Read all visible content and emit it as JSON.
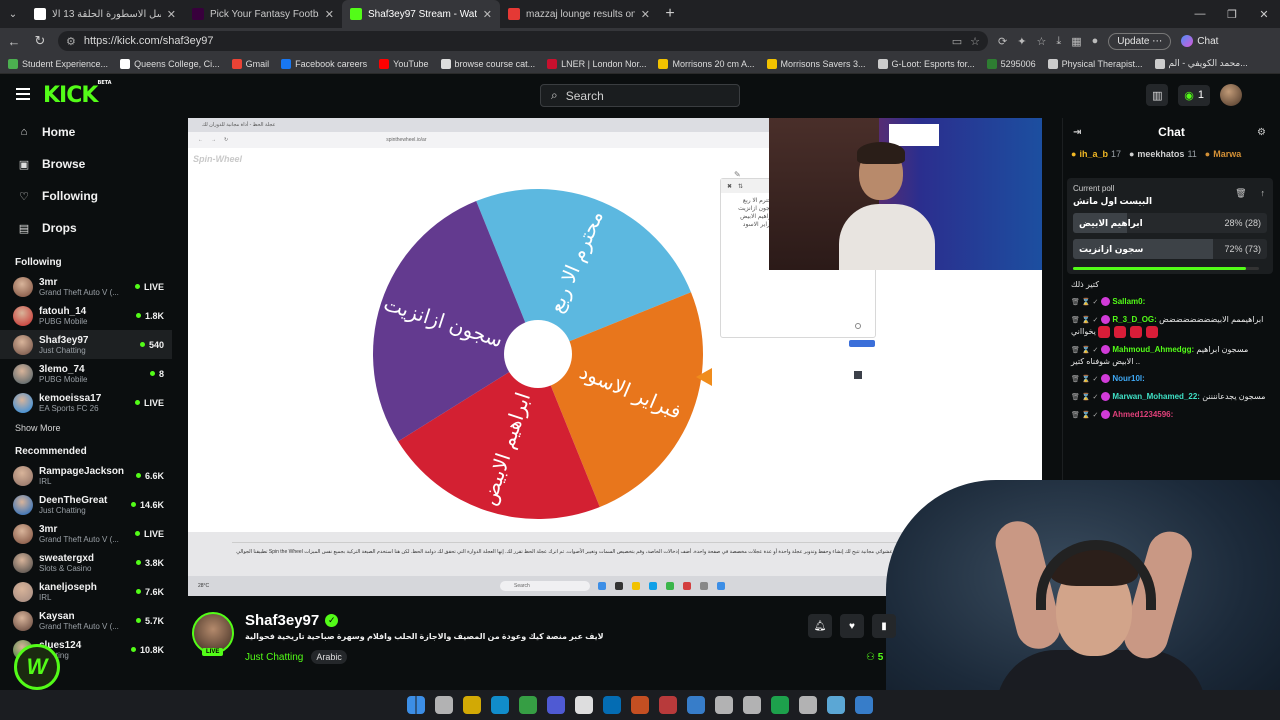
{
  "browser": {
    "tabs": [
      {
        "title": "مسلسل الاسطورة الحلقة 13 الا",
        "favicon_color": "#ffffff",
        "active": false
      },
      {
        "title": "Pick Your Fantasy Football Team |",
        "favicon_color": "#38003c",
        "active": false
      },
      {
        "title": "Shaf3ey97 Stream - Watch Live",
        "favicon_color": "#53fc18",
        "active": true
      },
      {
        "title": "mazzaj lounge results on Sou",
        "favicon_color": "#e53935",
        "active": false
      }
    ],
    "url": "https://kick.com/shaf3ey97",
    "update_label": "Update",
    "chat_label": "Chat",
    "bookmarks": [
      {
        "label": "Student Experience...",
        "color": "#4caf50"
      },
      {
        "label": "Queens College, Ci...",
        "color": "#ffffff"
      },
      {
        "label": "Gmail",
        "color": "#ea4335"
      },
      {
        "label": "Facebook careers",
        "color": "#1877f2"
      },
      {
        "label": "YouTube",
        "color": "#ff0000"
      },
      {
        "label": "browse course cat...",
        "color": "#dddddd"
      },
      {
        "label": "LNER | London Nor...",
        "color": "#c8102e"
      },
      {
        "label": "Morrisons 20 cm A...",
        "color": "#f2c200"
      },
      {
        "label": "Morrisons Savers 3...",
        "color": "#f2c200"
      },
      {
        "label": "G-Loot: Esports for...",
        "color": "#cccccc"
      },
      {
        "label": "5295006",
        "color": "#2e7d32"
      },
      {
        "label": "Physical Therapist...",
        "color": "#cccccc"
      },
      {
        "label": "محمد الكويفي - الم...",
        "color": "#cccccc"
      }
    ]
  },
  "header": {
    "logo": "KICK",
    "logo_badge": "BETA",
    "search_placeholder": "Search",
    "notification_count": "1"
  },
  "sidebar": {
    "nav": [
      {
        "label": "Home",
        "icon": "home-icon",
        "glyph": "⌂"
      },
      {
        "label": "Browse",
        "icon": "browse-icon",
        "glyph": "▣"
      },
      {
        "label": "Following",
        "icon": "heart-icon",
        "glyph": "♡"
      },
      {
        "label": "Drops",
        "icon": "drops-icon",
        "glyph": "▤"
      }
    ],
    "following_title": "Following",
    "following": [
      {
        "name": "3mr",
        "category": "Grand Theft Auto V (...",
        "viewers": "LIVE",
        "color": "#7a4b3a"
      },
      {
        "name": "fatouh_14",
        "category": "PUBG Mobile",
        "viewers": "1.8K",
        "color": "#c62828"
      },
      {
        "name": "Shaf3ey97",
        "category": "Just Chatting",
        "viewers": "540",
        "color": "#6d4c41"
      },
      {
        "name": "3lemo_74",
        "category": "PUBG Mobile",
        "viewers": "8",
        "color": "#455a64"
      },
      {
        "name": "kemoeissa17",
        "category": "EA Sports FC 26",
        "viewers": "LIVE",
        "color": "#1e88e5"
      }
    ],
    "show_more": "Show More",
    "recommended_title": "Recommended",
    "recommended": [
      {
        "name": "RampageJackson",
        "category": "IRL",
        "viewers": "6.6K",
        "color": "#8d6e63"
      },
      {
        "name": "DeenTheGreat",
        "category": "Just Chatting",
        "viewers": "14.6K",
        "color": "#1565c0"
      },
      {
        "name": "3mr",
        "category": "Grand Theft Auto V (...",
        "viewers": "LIVE",
        "color": "#7a4b3a"
      },
      {
        "name": "sweatergxd",
        "category": "Slots & Casino",
        "viewers": "3.8K",
        "color": "#424242"
      },
      {
        "name": "kaneljoseph",
        "category": "IRL",
        "viewers": "7.6K",
        "color": "#a1887f"
      },
      {
        "name": "Kaysan",
        "category": "Grand Theft Auto V (...",
        "viewers": "5.7K",
        "color": "#5d4037"
      },
      {
        "name": "clues124",
        "category": "Chatting",
        "viewers": "10.8K",
        "color": "#2e7d32"
      }
    ]
  },
  "video": {
    "inner_logo": "Spin-Wheel",
    "inner_url": "spinthewheel.io/ar",
    "inner_tab": "عجلة الحظ - أداة مجانية للدوران لك",
    "wheel": {
      "segments": [
        {
          "label": "محترم الا ربع",
          "color": "#5cb8e0"
        },
        {
          "label": "فبراير الاسود",
          "color": "#e8761c"
        },
        {
          "label": "ابراهيم الابيض",
          "color": "#d32032"
        },
        {
          "label": "سجون ازانزيت",
          "color": "#633a8f"
        }
      ]
    },
    "entries": [
      "محترم الا ربع",
      "سجون ازانزيت",
      "ابراهيم الابيض",
      "فبراير الاسود"
    ],
    "description": "هي أداة اختيار رقم عشوائي مجانية تتيح لك إنشاء وحفظ وتدوير عجلة واحدة أو عدة عجلات مخصصة في صفحة واحدة. أضف إدخالات الخاصة، وقم بتخصيص السمات وتغيير الأصوات. ثم اترك عجلة الحظ تقرر لك. إنها العجلة الدوارة التي تحقق لك دوامة الحظ. لكن هنا استخدم الصيغة التركية بجميع نفس الميزات Spin the Wheel تطبيقنا الجوالي بمجانيا.",
    "weather": "28°C",
    "taskbar_search": "Search"
  },
  "stream": {
    "streamer": "Shaf3ey97",
    "live_badge": "LIVE",
    "title": "لايف عبر منصة كيك وعودة من المصيف والاجازة الحلب وافلام وسهرة صباحية تاريخية فحوالية",
    "category": "Just Chatting",
    "language": "Arabic",
    "viewer_count": "5"
  },
  "chat": {
    "title": "Chat",
    "leaders": [
      {
        "name": "ih_a_b",
        "count": "17",
        "color": "#f2b824"
      },
      {
        "name": "meekhatos",
        "count": "11",
        "color": "#cfcfcf"
      },
      {
        "name": "Marwa",
        "count": "",
        "color": "#d39036"
      }
    ],
    "poll": {
      "label": "Current poll",
      "question": "البيست اول ماتش",
      "options": [
        {
          "label": "ابراهيم الابيض",
          "result": "28% (28)",
          "percent": 28
        },
        {
          "label": "سجون ازانزيت",
          "result": "72% (73)",
          "percent": 72
        }
      ],
      "time_remaining": 0.93
    },
    "messages": [
      {
        "user": "",
        "color": "#ffffff",
        "text": "كتير ذلك"
      },
      {
        "user": "Sallam0:",
        "color": "#53fc18",
        "text": ""
      },
      {
        "user": "R_3_D_OG:",
        "color": "#53fc18",
        "text": "ابراهيممم الابيضضضضضضضض يخوااني"
      },
      {
        "user": "Mahmoud_Ahmedgg:",
        "color": "#53fc18",
        "text": "مسجون ابراهيم الابيض شوفناه كتير .."
      },
      {
        "user": "Nour10l:",
        "color": "#3fa9f5",
        "text": ""
      },
      {
        "user": "Marwan_Mohamed_22:",
        "color": "#3fe0c5",
        "text": "مسجون يجدعاننننن"
      },
      {
        "user": "Ahmed1234596:",
        "color": "#e0407a",
        "text": ""
      }
    ]
  },
  "taskbar_colors": [
    "#3c8ee6",
    "#cccccc",
    "#f2c200",
    "#0fa0e8",
    "#3bb54a",
    "#5865f2",
    "#ffffff",
    "#007acc",
    "#e25822",
    "#d33f3f",
    "#3c8ee6",
    "#cccccc",
    "#cccccc",
    "#1db954",
    "#cccccc",
    "#66c0f4",
    "#3c8ee6"
  ]
}
